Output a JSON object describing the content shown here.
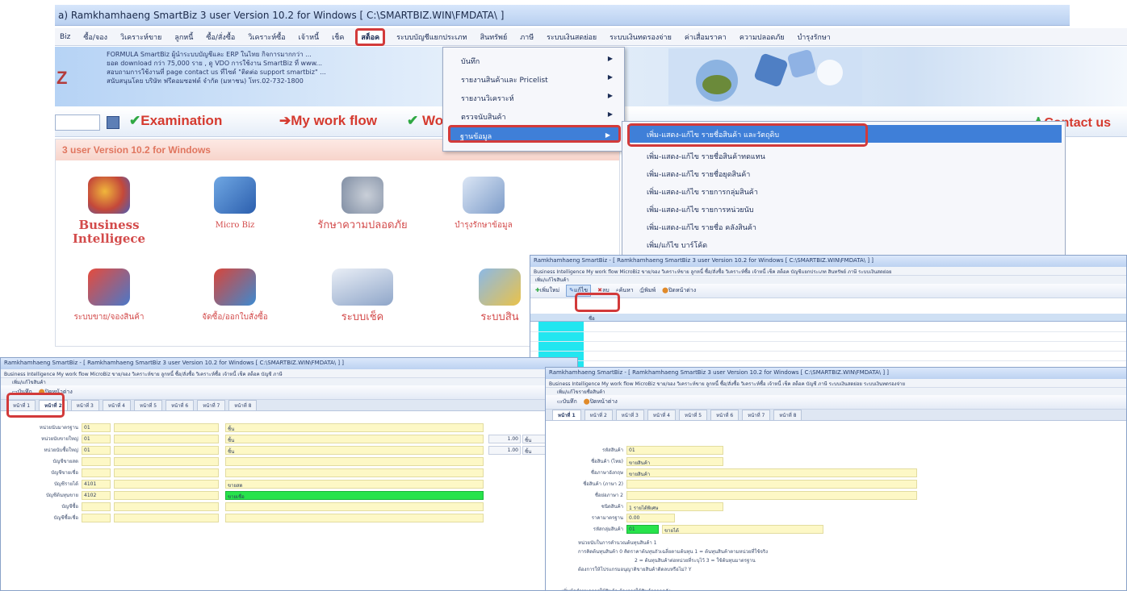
{
  "main": {
    "title": "a) Ramkhamhaeng SmartBiz 3 user Version 10.2 for Windows [ C:\\SMARTBIZ.WIN\\FMDATA\\ ]",
    "menu": [
      "Biz",
      "ซื้อ/จอง",
      "วิเคราะห์ขาย",
      "ลูกหนี้",
      "ซื้อ/สั่งซื้อ",
      "วิเคราะห์ซื้อ",
      "เจ้าหนี้",
      "เช็ค",
      "สต็อค",
      "ระบบบัญชีแยกประเภท",
      "สินทรัพย์",
      "ภาษี",
      "ระบบเงินสดย่อย",
      "ระบบเงินทดรองจ่าย",
      "ค่าเสื่อมราคา",
      "ความปลอดภัย",
      "บำรุงรักษา"
    ],
    "active_menu": "สต็อค",
    "banner_letter": "Z",
    "banner_lines": [
      "FORMULA SmartBiz ผู้นำระบบบัญชีและ ERP ในไทย กิจการมากกว่า ...",
      "ยอด download กว่า 75,000 ราย , ดู VDO การใช้งาน SmartBiz ที่ www...",
      "สอบถามการใช้งานที่ page contact us ที่ไซด์ \"ติดต่อ support smartbiz\" ...",
      "สนับสนุนโดย บริษัท ฟรีดอมซอฟต์ จำกัด (มหาชน) โทร.02-732-1800"
    ],
    "toolstrip": {
      "examination": "Examination",
      "workflow": "My work flow",
      "wo": "Wo",
      "contact": "Contact us"
    },
    "panel_title": "3 user Version 10.2 for Windows",
    "modules": [
      {
        "label": "Business Intelligece",
        "icon": "business-intelligence-icon"
      },
      {
        "label": "Micro Biz",
        "icon": "micro-biz-icon"
      },
      {
        "label": "รักษาความปลอดภัย",
        "icon": "security-icon"
      },
      {
        "label": "บำรุงรักษาข้อมูล",
        "icon": "maintenance-icon"
      },
      {
        "label": "ระบบขาย/จองสินค้า",
        "icon": "sales-icon"
      },
      {
        "label": "จัดซื้อ/ออกใบสั่งซื้อ",
        "icon": "purchase-icon"
      },
      {
        "label": "ระบบเช็ค",
        "icon": "cheque-icon"
      },
      {
        "label": "ระบบสิน",
        "icon": "inventory-icon"
      }
    ],
    "dropdown": [
      {
        "label": "บันทึก",
        "arrow": "▶"
      },
      {
        "label": "รายงานสินค้าและ Pricelist",
        "arrow": "▶"
      },
      {
        "label": "รายงานวิเคราะห์",
        "arrow": "▶"
      },
      {
        "label": "ตรวจนับสินค้า",
        "arrow": "▶"
      },
      {
        "label": "ฐานข้อมูล",
        "arrow": "▶"
      }
    ],
    "submenu": [
      "เพิ่ม-แสดง-แก้ไข รายชื่อสินค้า และวัตถุดิบ",
      "เพิ่ม-แสดง-แก้ไข รายชื่อสินค้าทดแทน",
      "เพิ่ม-แสดง-แก้ไข รายชื่อยุดสินค้า",
      "เพิ่ม-แสดง-แก้ไข รายการกลุ่มสินค้า",
      "เพิ่ม-แสดง-แก้ไข รายการหน่วยนับ",
      "เพิ่ม-แสดง-แก้ไข รายชื่อ คลังสินค้า",
      "เพิ่ม/แก้ไข บาร์โค้ด"
    ]
  },
  "win_list": {
    "title": "Ramkhamhaeng SmartBiz - [ Ramkhamhaeng SmartBiz 3 user Version 10.2 for Windows [ C:\\SMARTBIZ.WIN\\FMDATA\\ ] ]",
    "menu": "Business Intelligence   My work flow   MicroBiz   ขาย/จอง   วิเคราะห์ขาย   ลูกหนี้   ซื้อ/สั่งซื้อ   วิเคราะห์ซื้อ   เจ้าหนี้   เช็ค   สต็อค   บัญชีแยกประเภท   สินทรัพย์   ภาษี   ระบบเงินสดย่อย",
    "sub": "เพิ่ม/แก้ไขสินค้า",
    "toolbar": [
      "เพิ่มใหม่",
      "แก้ไข",
      "ลบ",
      "ค้นหา",
      "พิมพ์",
      "ปิดหน้าต่าง"
    ],
    "grid_header": "ชื่อ"
  },
  "win_form_left": {
    "title": "Ramkhamhaeng SmartBiz - [ Ramkhamhaeng SmartBiz 3 user Version 10.2 for Windows [ C:\\SMARTBIZ.WIN\\FMDATA\\ ] ]",
    "menu": "Business Intelligence   My work flow   MicroBiz   ขาย/จอง   วิเคราะห์ขาย   ลูกหนี้   ซื้อ/สั่งซื้อ   วิเคราะห์ซื้อ   เจ้าหนี้   เช็ค   สต็อค   บัญชี   ภาษี",
    "sub": "เพิ่ม/แก้ไขสินค้า",
    "toolbar": [
      "บันทึก",
      "ปิดหน้าต่าง"
    ],
    "tabs": [
      "หน้าที่ 1",
      "หน้าที่ 2",
      "หน้าที่ 3",
      "หน้าที่ 4",
      "หน้าที่ 5",
      "หน้าที่ 6",
      "หน้าที่ 7",
      "หน้าที่ 8"
    ],
    "active_tab": "หน้าที่ 2",
    "fields": [
      {
        "label": "หน่วยนับมาตรฐาน",
        "code": "01",
        "value": "ชิ้น"
      },
      {
        "label": "หน่วยนับขายใหญ่",
        "code": "01",
        "value": "ชิ้น",
        "qty": "1.00",
        "unit": "ชิ้น"
      },
      {
        "label": "หน่วยนับซื้อใหญ่",
        "code": "01",
        "value": "ชิ้น",
        "qty": "1.00",
        "unit": "ชิ้น"
      },
      {
        "label": "บัญชีขายสด",
        "code": "",
        "value": ""
      },
      {
        "label": "บัญชีขายเชื่อ",
        "code": "",
        "value": ""
      },
      {
        "label": "บัญชีรายได้",
        "code": "4101",
        "value": "ขายสด"
      },
      {
        "label": "บัญชีต้นทุนขาย",
        "code": "4102",
        "value": "ขายเชื่อ"
      },
      {
        "label": "บัญชีซื้อ",
        "code": "",
        "value": ""
      },
      {
        "label": "บัญชีซื้อเชื่อ",
        "code": "",
        "value": ""
      }
    ]
  },
  "win_form_right": {
    "title": "Ramkhamhaeng SmartBiz - [ Ramkhamhaeng SmartBiz 3 user Version 10.2 for Windows [ C:\\SMARTBIZ.WIN\\FMDATA\\ ] ]",
    "menu": "Business Intelligence   My work flow   MicroBiz   ขาย/จอง   วิเคราะห์ขาย   ลูกหนี้   ซื้อ/สั่งซื้อ   วิเคราะห์ซื้อ   เจ้าหนี้   เช็ค   สต็อค   บัญชี   ภาษี   ระบบเงินสดย่อย   ระบบเงินทดรองจ่าย",
    "sub": "เพิ่ม/แก้ไขรายชื่อสินค้า",
    "toolbar": [
      "บันทึก",
      "ปิดหน้าต่าง"
    ],
    "tabs": [
      "หน้าที่ 1",
      "หน้าที่ 2",
      "หน้าที่ 3",
      "หน้าที่ 4",
      "หน้าที่ 5",
      "หน้าที่ 6",
      "หน้าที่ 7",
      "หน้าที่ 8"
    ],
    "active_tab": "หน้าที่ 1",
    "fields": [
      {
        "label": "รหัสสินค้า",
        "value": "01"
      },
      {
        "label": "ชื่อสินค้า (ไทย)",
        "value": "ขายสินค้า"
      },
      {
        "label": "ชื่อภาษาอังกฤษ",
        "value": "ขายสินค้า"
      },
      {
        "label": "ชื่อสินค้า (ภาษา 2)",
        "value": ""
      },
      {
        "label": "ชื่อย่อภาษา 2",
        "value": ""
      },
      {
        "label": "ชนิดสินค้า",
        "value": "1   รายได้พิเศษ"
      },
      {
        "label": "ราคามาตรฐาน",
        "value": "0.00"
      },
      {
        "label": "รหัสกลุ่มสินค้า",
        "value": "01",
        "extra": "ขายได้"
      }
    ],
    "notes": [
      "หน่วยนับในการคำนวณต้นทุนสินค้า  1",
      "การคิดต้นทุนสินค้า   0   คิดราคาต้นทุนถัวเฉลี่ยตามต้นทุน   1 = ต้นทุนสินค้าตามหน่วยที่ใช้จริง",
      "2 = ต้นทุนสินค้าต่อหน่วยที่ระบุไว้   3 = ใช้ต้นทุนมาตรฐาน",
      "ต้องการให้โปรแกรมอนุญาติขายสินค้าติดลบหรือไม่?   Y",
      "เพิ่มข้อกำหนดการใช้สินค้า ต้องการใช้สินค้าจากคลัง   ..."
    ]
  }
}
